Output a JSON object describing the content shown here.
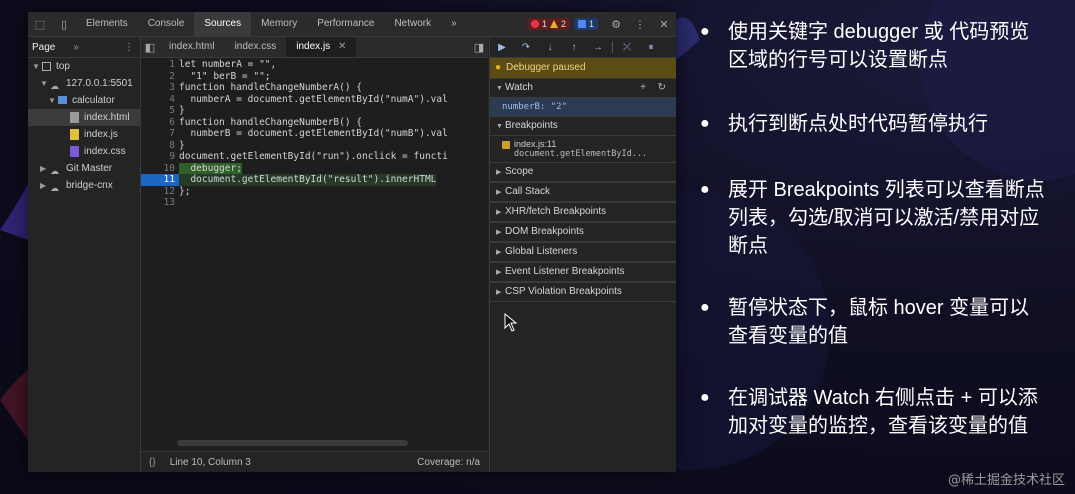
{
  "devtools": {
    "tabs": [
      "Elements",
      "Console",
      "Sources",
      "Memory",
      "Performance",
      "Network"
    ],
    "active_tab": "Sources",
    "more_tabs": "»",
    "errors": "1",
    "warnings": "2",
    "messages": "1",
    "navigator": {
      "title": "Page",
      "more": "»",
      "items": [
        "top",
        "127.0.0.1:5501",
        "calculator",
        "index.html",
        "index.js",
        "index.css",
        "Git Master",
        "bridge-cnx"
      ]
    },
    "editor": {
      "tabs": [
        "index.html",
        "index.css",
        "index.js"
      ],
      "lines": [
        {
          "n": "1",
          "text": "let numberA = \"\","
        },
        {
          "n": "2",
          "text": "  \"1\" berB = \"\";"
        },
        {
          "n": "3",
          "text": "function handleChangeNumberA() {"
        },
        {
          "n": "4",
          "text": "  numberA = document.getElementById(\"numA\").val"
        },
        {
          "n": "5",
          "text": "}"
        },
        {
          "n": "6",
          "text": "function handleChangeNumberB() {"
        },
        {
          "n": "7",
          "text": "  numberB = document.getElementById(\"numB\").val"
        },
        {
          "n": "8",
          "text": "}"
        },
        {
          "n": "9",
          "text": "document.getElementById(\"run\").onclick = functi"
        },
        {
          "n": "10",
          "text": "  debugger;"
        },
        {
          "n": "11",
          "text": "  document.getElementById(\"result\").innerHTML"
        },
        {
          "n": "12",
          "text": "};"
        },
        {
          "n": "13",
          "text": ""
        }
      ],
      "status_left": "Line 10, Column 3",
      "status_right": "Coverage: n/a",
      "status_icon": "{}"
    },
    "debugger": {
      "paused": "Debugger paused",
      "watch_title": "Watch",
      "watch_add": "+",
      "watch_refresh": "↻",
      "watch_value": "numberB: \"2\"",
      "breakpoints_title": "Breakpoints",
      "breakpoint_file": "index.js:11",
      "breakpoint_code": "document.getElementById...",
      "sections": [
        "Scope",
        "Call Stack",
        "XHR/fetch Breakpoints",
        "DOM Breakpoints",
        "Global Listeners",
        "Event Listener Breakpoints",
        "CSP Violation Breakpoints"
      ]
    }
  },
  "bullets": [
    "使用关键字 debugger 或 代码预览区域的行号可以设置断点",
    "执行到断点处时代码暂停执行",
    "展开 Breakpoints 列表可以查看断点列表，勾选/取消可以激活/禁用对应断点",
    "暂停状态下，鼠标 hover 变量可以查看变量的值",
    "在调试器 Watch 右侧点击 + 可以添加对变量的监控，查看该变量的值"
  ],
  "watermark": "@稀土掘金技术社区",
  "colors": {
    "paused_bar": "#5a4c12",
    "breakpoint_line": "#1a66c2",
    "paused_line": "#2f5f2a"
  }
}
